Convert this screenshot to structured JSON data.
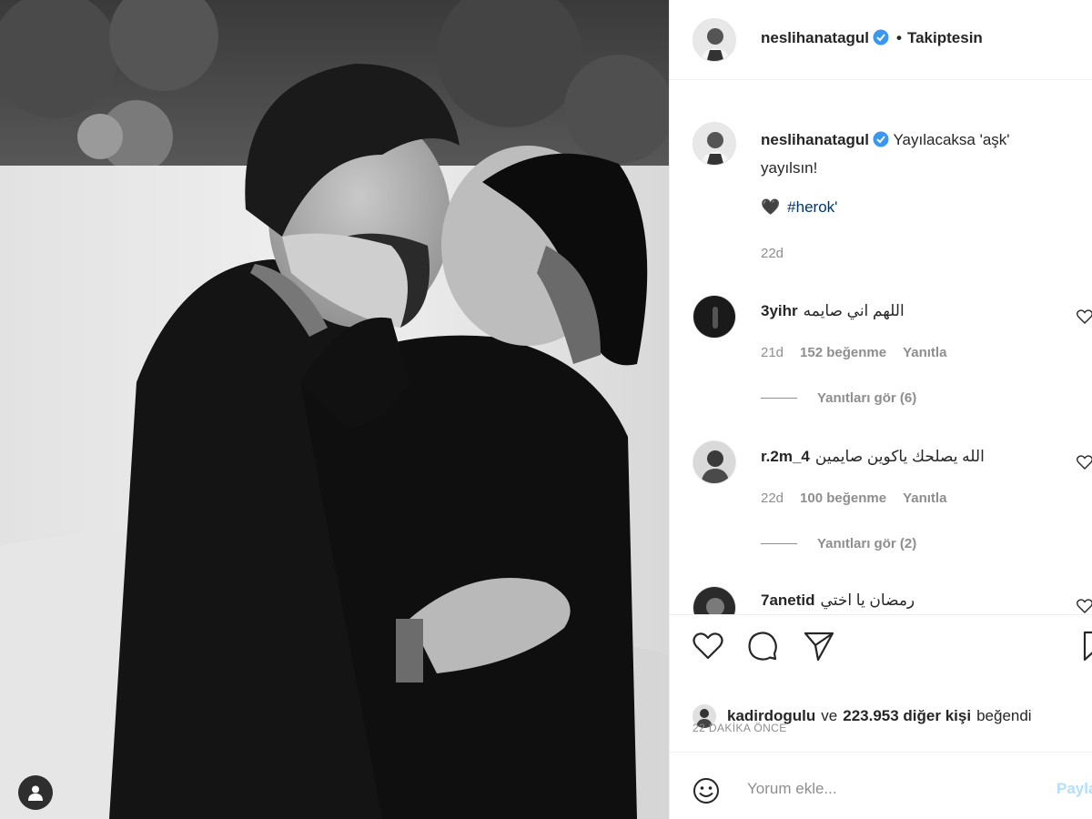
{
  "post": {
    "username": "neslihanatagul",
    "follow_status": "Takiptesin",
    "dot": "•"
  },
  "caption": {
    "username": "neslihanatagul",
    "text_line1": "Yayılacaksa 'aşk'",
    "text_line2": "yayılsın!",
    "emoji": "🖤",
    "hashtag": "#herok'",
    "time": "22d"
  },
  "comments": [
    {
      "username": "3yihr",
      "text": "اللهم اني صايمه",
      "time": "21d",
      "likes": "152 beğenme",
      "reply_label": "Yanıtla",
      "view_replies": "Yanıtları gör (6)"
    },
    {
      "username": "r.2m_4",
      "text": "الله يصلحك ياكوين صايمين",
      "time": "22d",
      "likes": "100 beğenme",
      "reply_label": "Yanıtla",
      "view_replies": "Yanıtları gör (2)"
    },
    {
      "username": "7anetid",
      "text": "رمضان يا اختي"
    }
  ],
  "likes": {
    "user": "kadirdogulu",
    "connector": "ve",
    "count": "223.953 diğer kişi",
    "suffix": "beğendi"
  },
  "post_time": "22 DAKİKA ÖNCE",
  "comment_input": {
    "placeholder": "Yorum ekle...",
    "share_label": "Paylaş"
  },
  "colors": {
    "link": "#00376b",
    "verified": "#3897f0",
    "muted": "#8e8e8e",
    "share_disabled": "#b2dffc"
  },
  "icons": {
    "like": "heart-icon",
    "comment": "comment-icon",
    "share": "paper-plane-icon",
    "save": "bookmark-icon",
    "emoji": "smiley-icon",
    "tag": "user-tag-icon"
  }
}
